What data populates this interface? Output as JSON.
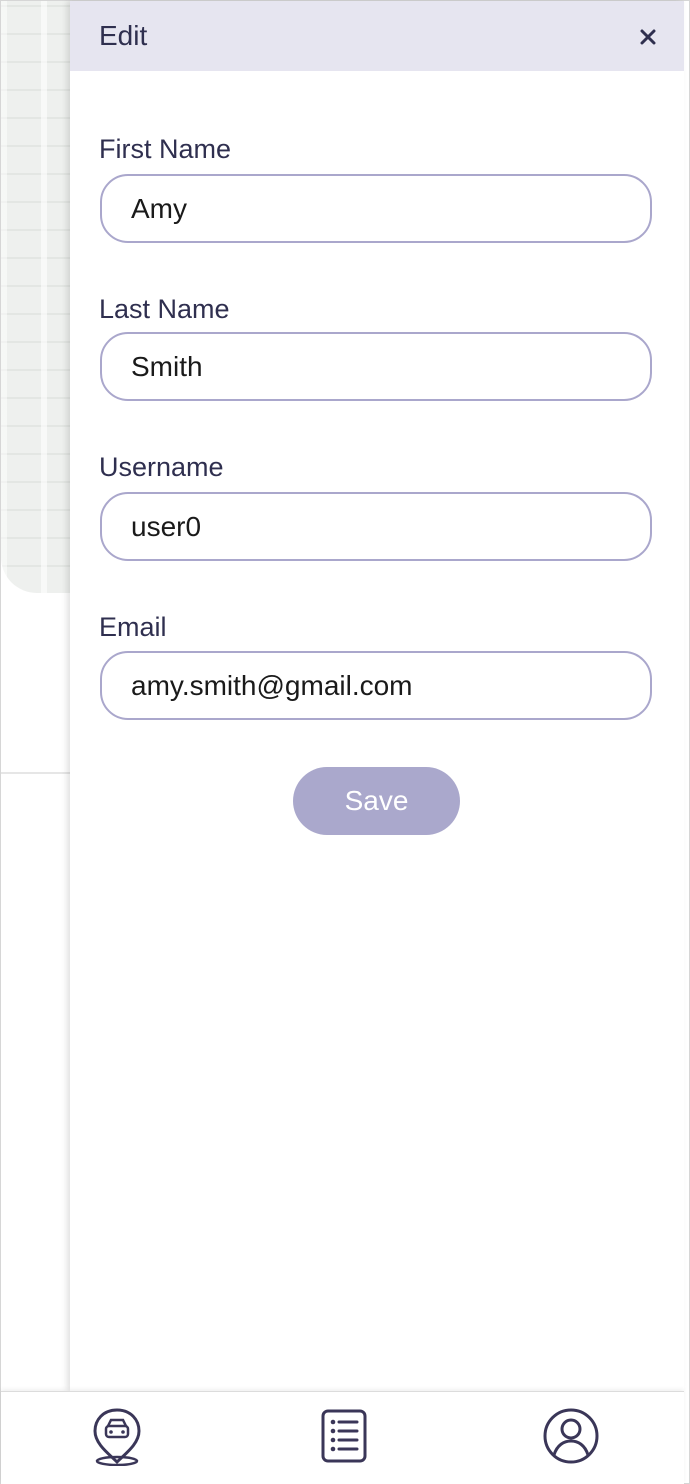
{
  "drawer": {
    "title": "Edit",
    "close_icon": "close-icon"
  },
  "form": {
    "first_name": {
      "label": "First Name",
      "value": "Amy"
    },
    "last_name": {
      "label": "Last Name",
      "value": "Smith"
    },
    "username": {
      "label": "Username",
      "value": "user0"
    },
    "email": {
      "label": "Email",
      "value": "amy.smith@gmail.com"
    },
    "save_label": "Save"
  },
  "bottom_nav": {
    "items": [
      {
        "icon": "map-pin-car-icon"
      },
      {
        "icon": "list-icon"
      },
      {
        "icon": "user-profile-icon"
      }
    ]
  },
  "colors": {
    "header_bg": "#e6e5f0",
    "input_border": "#aaa7cc",
    "save_button_bg": "#aaa8cc",
    "text_dark": "#2f2f4f",
    "icon_color": "#3a3658"
  }
}
